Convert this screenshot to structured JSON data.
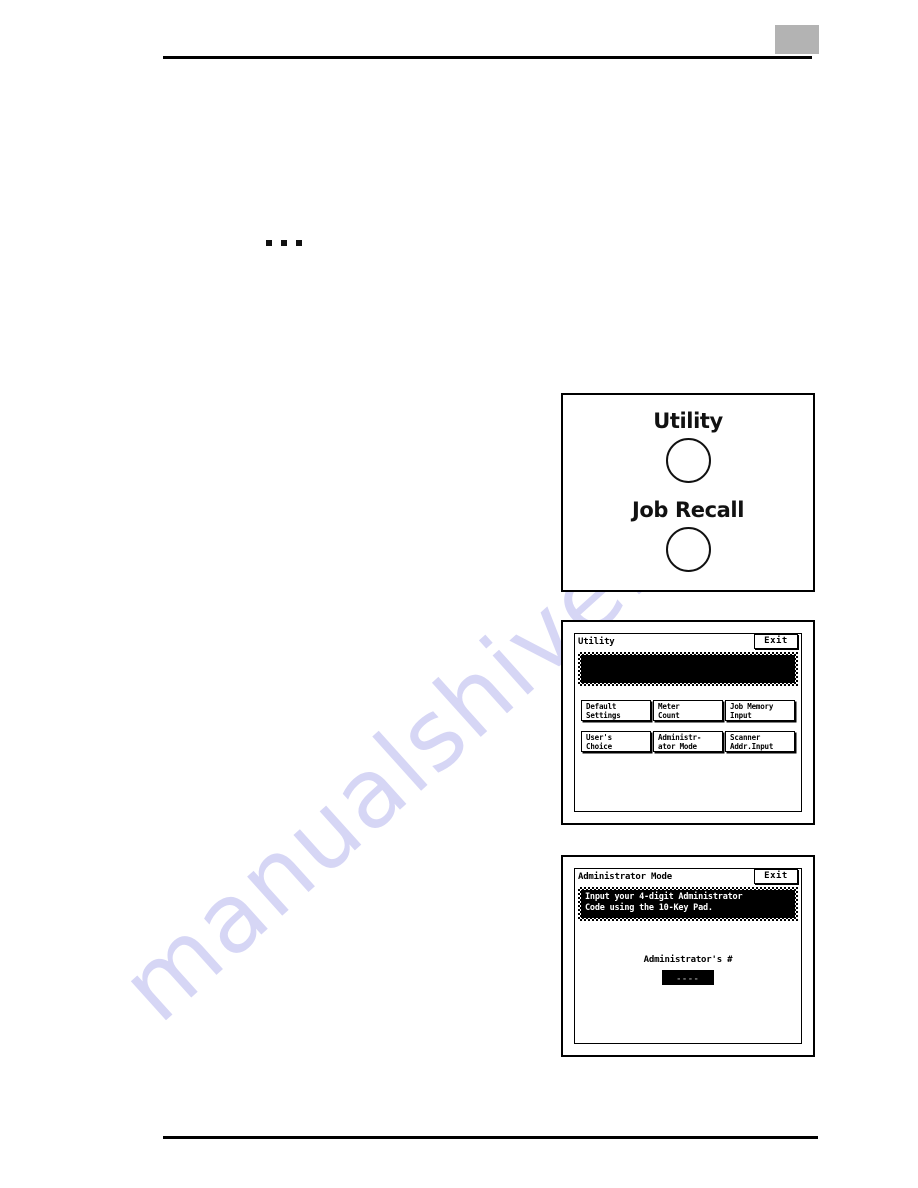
{
  "page": {
    "watermark_text": "manualshive.com",
    "header_box_color": "#b3b3b3",
    "ellipsis": "• • •"
  },
  "figures": {
    "operator_keys": {
      "keys": [
        {
          "label": "Utility",
          "icon": "round-button-icon"
        },
        {
          "label": "Job Recall",
          "icon": "round-button-icon"
        }
      ]
    },
    "utility_screen": {
      "title": "Utility",
      "exit_label": "Exit",
      "message_lines": [
        "",
        ""
      ],
      "buttons": [
        {
          "line1": "Default",
          "line2": "Settings"
        },
        {
          "line1": "Meter",
          "line2": "Count"
        },
        {
          "line1": "Job Memory",
          "line2": "Input"
        },
        {
          "line1": "User's",
          "line2": "Choice"
        },
        {
          "line1": "Administr-",
          "line2": "ator Mode"
        },
        {
          "line1": "Scanner",
          "line2": "Addr.Input"
        }
      ]
    },
    "admin_screen": {
      "title": "Administrator Mode",
      "exit_label": "Exit",
      "message_lines": [
        "Input your 4-digit Administrator",
        "Code using the 10-Key Pad."
      ],
      "field_label": "Administrator's #",
      "field_value": "----"
    }
  }
}
